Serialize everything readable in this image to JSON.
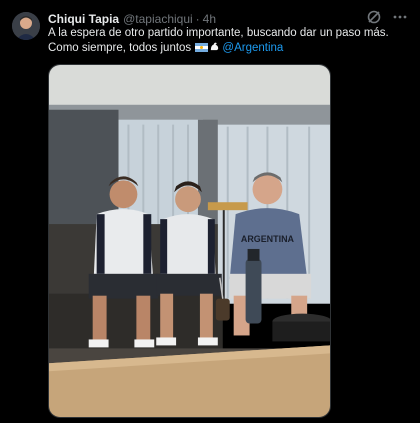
{
  "tweet": {
    "display_name": "Chiqui Tapia",
    "handle": "@tapiachiqui",
    "separator": "·",
    "time": "4h",
    "text_line1": "A la espera de otro partido importante, buscando dar un paso más. Como siempre, todos juntos",
    "mention": "@Argentina"
  },
  "photo": {
    "shirt_text": "ARGENTINA"
  },
  "icons": {
    "grok": "grok-icon",
    "more": "more-icon",
    "flag": "argentina-flag-icon",
    "bicep": "flexed-bicep-icon"
  },
  "colors": {
    "background": "#000000",
    "text": "#e7e9ea",
    "muted": "#71767b",
    "link": "#1d9bf0"
  }
}
